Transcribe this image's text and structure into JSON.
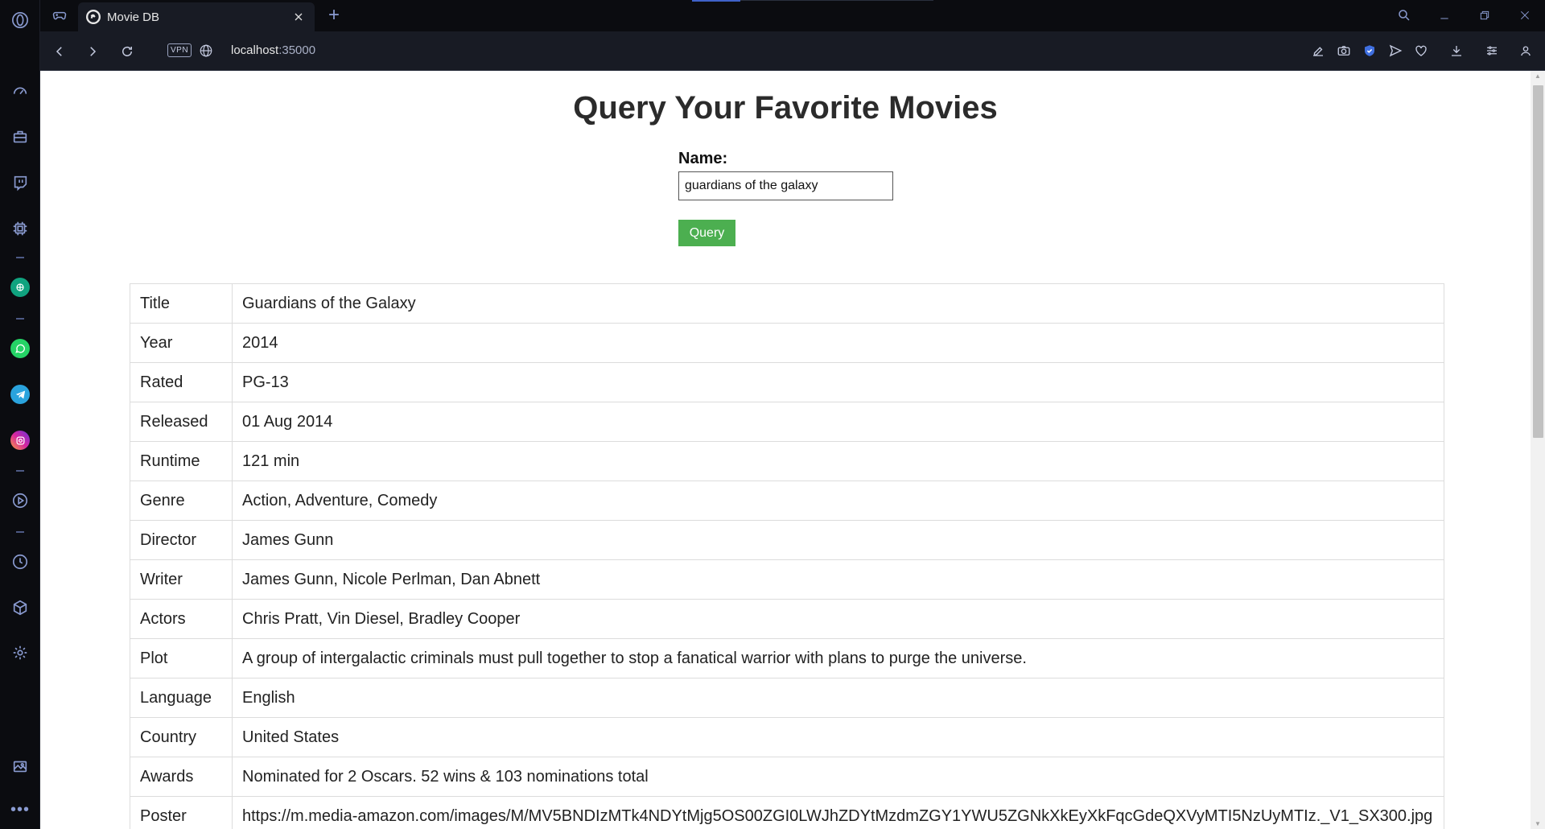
{
  "browser": {
    "tab": {
      "title": "Movie DB"
    },
    "address": {
      "host": "localhost",
      "port": ":35000"
    },
    "vpn_label": "VPN"
  },
  "page": {
    "title": "Query Your Favorite Movies",
    "form": {
      "name_label": "Name:",
      "name_value": "guardians of the galaxy",
      "query_button": "Query"
    },
    "movie": [
      {
        "key": "Title",
        "value": "Guardians of the Galaxy"
      },
      {
        "key": "Year",
        "value": "2014"
      },
      {
        "key": "Rated",
        "value": "PG-13"
      },
      {
        "key": "Released",
        "value": "01 Aug 2014"
      },
      {
        "key": "Runtime",
        "value": "121 min"
      },
      {
        "key": "Genre",
        "value": "Action, Adventure, Comedy"
      },
      {
        "key": "Director",
        "value": "James Gunn"
      },
      {
        "key": "Writer",
        "value": "James Gunn, Nicole Perlman, Dan Abnett"
      },
      {
        "key": "Actors",
        "value": "Chris Pratt, Vin Diesel, Bradley Cooper"
      },
      {
        "key": "Plot",
        "value": "A group of intergalactic criminals must pull together to stop a fanatical warrior with plans to purge the universe."
      },
      {
        "key": "Language",
        "value": "English"
      },
      {
        "key": "Country",
        "value": "United States"
      },
      {
        "key": "Awards",
        "value": "Nominated for 2 Oscars. 52 wins & 103 nominations total"
      },
      {
        "key": "Poster",
        "value": "https://m.media-amazon.com/images/M/MV5BNDIzMTk4NDYtMjg5OS00ZGI0LWJhZDYtMzdmZGY1YWU5ZGNkXkEyXkFqcGdeQXVyMTI5NzUyMTIz._V1_SX300.jpg"
      }
    ]
  },
  "colors": {
    "sidebar_bg": "#0b0c10",
    "toolbar_bg": "#181b24",
    "accent_icon": "#8a9bd1",
    "query_button": "#4caf50"
  },
  "icons": {
    "sidebar": [
      "opera-logo-icon",
      "speed-dial-icon",
      "briefcase-icon",
      "twitch-icon",
      "cpu-icon",
      "chatgpt-icon",
      "whatsapp-icon",
      "telegram-icon",
      "instagram-icon",
      "player-icon",
      "history-icon",
      "cube-icon",
      "settings-icon",
      "gallery-icon",
      "more-icon"
    ],
    "toolbar": [
      "snapshot-edit-icon",
      "camera-icon",
      "shield-icon",
      "send-icon",
      "heart-icon",
      "download-icon",
      "easy-setup-icon",
      "profile-icon"
    ]
  }
}
